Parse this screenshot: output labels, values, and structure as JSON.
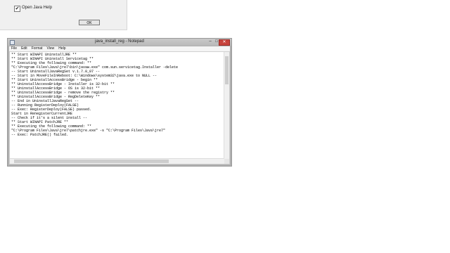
{
  "dialog": {
    "checkbox_label": "Open Java Help",
    "checkbox_mark": "✔",
    "ok_label": "OK"
  },
  "notepad": {
    "title": "java_install_reg - Notepad",
    "buttons": {
      "minimize": "–",
      "maximize": "□",
      "close": "✕"
    },
    "menu": [
      "File",
      "Edit",
      "Format",
      "View",
      "Help"
    ],
    "lines": [
      "** Start WINAPI UninstallJRE **",
      "** Start WINAPI Uninstall Servicetag **",
      "** Executing the following command: **",
      "\"C:\\Program Files\\Java\\jre7\\bin\\javaw.exe\" com.sun.servicetag.Installer -delete",
      "-- Start UninstallJavaRegSet v.1.7.0_07 --",
      "-- Start in MoveFileInReboot: C:\\Windows\\system32\\java.exe to NULL --",
      "** Start UninstallAccessBridge - begin **",
      "** UninstallAccessBridge - Installer is 32-bit **",
      "** UninstallAccessBridge - OS is 32-bit **",
      "** UninstallAccessBridge - remove the registry **",
      "** UninstallAccessBridge - RegDeleteKey **",
      "-- End in UninstallJavaRegSet --",
      "-- Running RegisterDeploy(FALSE)",
      "-- Exec: RegisterDeploy(FALSE) passed.",
      "Start in RenegisterCurrentJRE",
      "-- Check if it's a silent install --",
      "** Start WINAPI PatchJRE **",
      "** Executing the following command: **",
      "\"C:\\Program Files\\Java\\jre7\\patchjre.exe\" -s \"C:\\Program Files\\Java\\jre7\"",
      "-- Exec: PatchJRE() failed."
    ]
  }
}
